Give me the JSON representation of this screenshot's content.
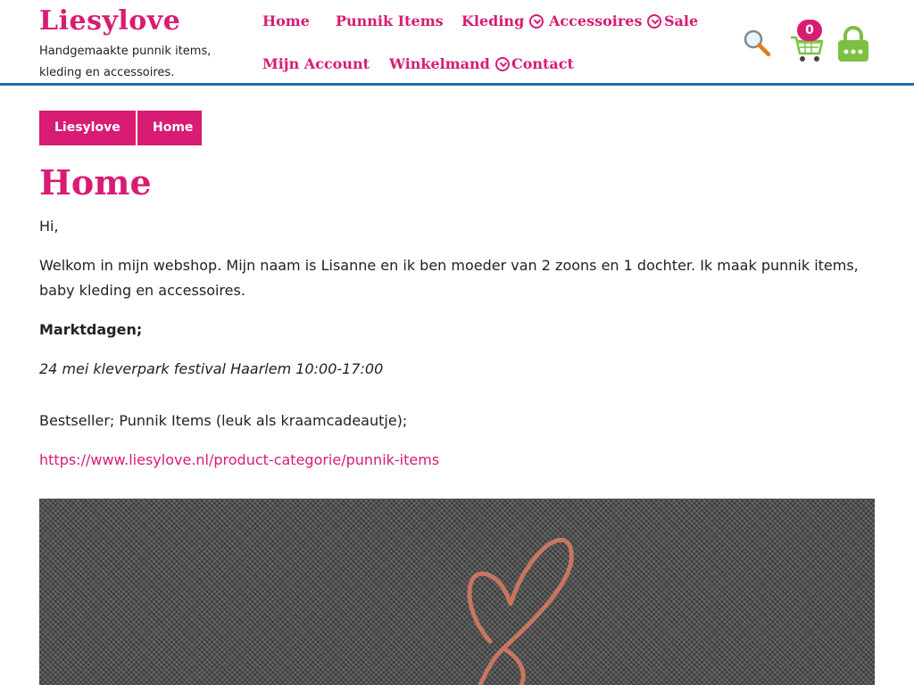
{
  "brand": {
    "title": "Liesylove",
    "tagline": "Handgemaakte punnik items, kleding en accessoires."
  },
  "nav": {
    "home": "Home",
    "punnik_items": "Punnik Items",
    "kleding": "Kleding",
    "accessoires": "Accessoires",
    "sale": "Sale",
    "mijn_account": "Mijn Account",
    "winkelmand": "Winkelmand",
    "contact": "Contact"
  },
  "header_icons": {
    "search": "search-icon",
    "cart": "cart-icon",
    "cart_count": "0",
    "lock": "lock-icon"
  },
  "breadcrumb": [
    "Liesylove",
    "Home"
  ],
  "page": {
    "title": "Home",
    "greeting": "Hi,",
    "intro": "Welkom in mijn webshop. Mijn naam is Lisanne en ik ben moeder van 2 zoons en 1 dochter. Ik maak punnik items, baby kleding en accessoires.",
    "markets_heading": "Marktdagen;",
    "market_event": "24 mei kleverpark festival Haarlem 10:00-17:00",
    "bestseller": "Bestseller; Punnik Items (leuk als kraamcadeautje);",
    "link": "https://www.liesylove.nl/product-categorie/punnik-items"
  },
  "colors": {
    "accent": "#d81b73",
    "header_border": "#1e6fae",
    "cart_green": "#7bc043",
    "hero_bg": "#4a4a4a",
    "yarn": "#c7765f"
  }
}
